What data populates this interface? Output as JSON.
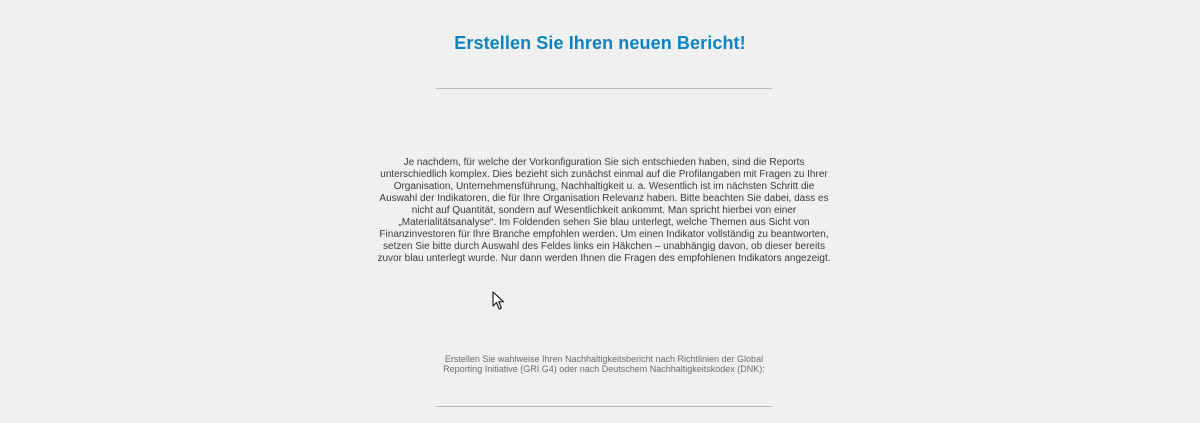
{
  "report": {
    "title": "Erstellen Sie Ihren neuen Bericht!",
    "intro_text": "Je nachdem, für welche der Vorkonfiguration Sie sich entschieden haben, sind die Reports unterschiedlich komplex. Dies bezieht sich zunächst einmal auf die Profilangaben mit Fragen zu Ihrer Organisation, Unternehmensführung, Nachhaltigkeit u. a. Wesentlich ist im nächsten Schritt die Auswahl der Indikatoren, die für Ihre Organisation Relevanz haben. Bitte beachten Sie dabei, dass es nicht auf Quantität, sondern auf Wesentlichkeit ankommt. Man spricht hierbei von einer „Materialitätsanalyse“. Im Foldenden sehen Sie blau unterlegt, welche Themen aus Sicht von Finanzinvestoren für Ihre Branche empfohlen werden. Um einen Indikator vollständig zu beantworten, setzen Sie bitte durch Auswahl des Feldes links ein Häkchen – unabhängig davon, ob dieser bereits zuvor blau unterlegt wurde. Nur dann werden Ihnen die Fragen des empfohlenen Indikators angezeigt.",
    "standards_text": "Erstellen Sie wahlweise Ihren Nachhaltigkeitsbericht nach Richtlinien der Global Reporting Initiative (GRI G4) oder nach Deutschem Nachhaltigkeitskodex (DNK):"
  },
  "theme": {
    "accent": "#0a84c6",
    "background": "#efefef",
    "text": "#3c3c3c",
    "muted_text": "#6b6b6b",
    "divider": "#b8b8b8"
  },
  "icons": {
    "cursor": "mouse-pointer-icon"
  }
}
